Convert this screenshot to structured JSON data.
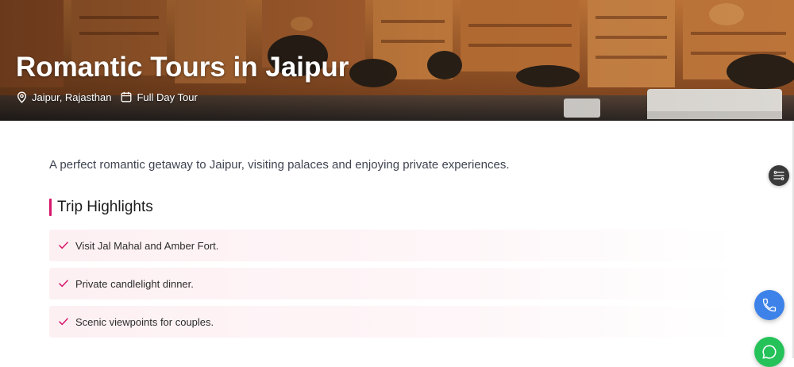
{
  "hero": {
    "title": "Romantic Tours in Jaipur",
    "location": "Jaipur, Rajasthan",
    "duration": "Full Day Tour",
    "location_icon": "map-pin-icon",
    "duration_icon": "calendar-icon"
  },
  "intro": "A perfect romantic getaway to Jaipur, visiting palaces and enjoying private experiences.",
  "highlights": {
    "title": "Trip Highlights",
    "items": [
      "Visit Jal Mahal and Amber Fort.",
      "Private candlelight dinner.",
      "Scenic viewpoints for couples."
    ],
    "check_icon": "check-icon"
  },
  "floating": {
    "toc_icon": "list-settings-icon",
    "call_icon": "phone-icon",
    "chat_icon": "whatsapp-icon"
  },
  "colors": {
    "accent": "#d6176b",
    "call": "#3d82e8",
    "whatsapp": "#25c25a",
    "highlight_bg": "#fdf0f3"
  }
}
